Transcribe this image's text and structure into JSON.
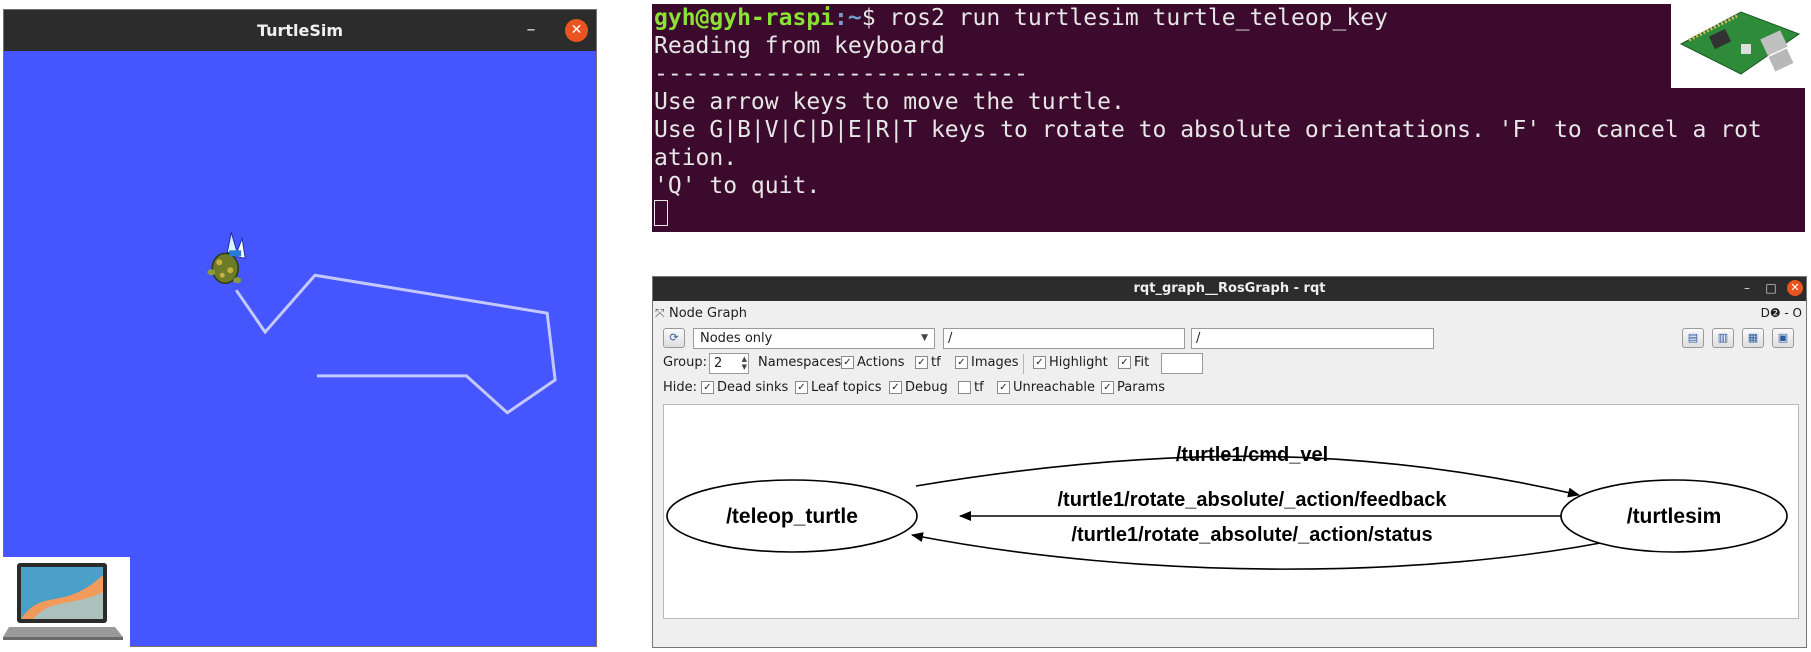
{
  "turtlesim": {
    "title": "TurtleSim",
    "minimize_glyph": "–",
    "close_glyph": "✕",
    "colors": {
      "background": "#4556fe",
      "titlebar": "#2c2c2c",
      "close": "#e95420",
      "path": "#c3c8ff"
    }
  },
  "terminal": {
    "prompt_user": "gyh@gyh-raspi",
    "prompt_path": ":~",
    "prompt_symbol": "$ ",
    "command": "ros2 run turtlesim turtle_teleop_key",
    "lines": [
      "Reading from keyboard",
      "---------------------------",
      "Use arrow keys to move the turtle.",
      "Use G|B|V|C|D|E|R|T keys to rotate to absolute orientations. 'F' to cancel a rot",
      "ation.",
      "'Q' to quit."
    ],
    "colors": {
      "background": "#3c0a2d",
      "user": "#8ae234",
      "path": "#729fcf"
    }
  },
  "rqt": {
    "title": "rqt_graph__RosGraph - rqt",
    "window_buttons": {
      "minimize": "–",
      "maximize": "□",
      "close": "✕"
    },
    "plugin_title": "Node Graph",
    "plugin_controls": "D❷ - O",
    "toolbar": {
      "refresh_icon": "⟳",
      "mode_value": "Nodes only",
      "filter_1": "/",
      "filter_2": "/",
      "group_label": "Group:",
      "group_value": "2",
      "options": [
        {
          "label": "Namespaces",
          "checked": true
        },
        {
          "label": "Actions",
          "checked": true
        },
        {
          "label": "tf",
          "checked": true
        },
        {
          "label": "Images",
          "checked": true
        },
        {
          "label": "Highlight",
          "checked": true
        },
        {
          "label": "Fit",
          "checked": true
        }
      ],
      "hide_label": "Hide:",
      "hide_options": [
        {
          "label": "Dead sinks",
          "checked": true
        },
        {
          "label": "Leaf topics",
          "checked": true
        },
        {
          "label": "Debug",
          "checked": true
        },
        {
          "label": "tf",
          "checked": false
        },
        {
          "label": "Unreachable",
          "checked": true
        },
        {
          "label": "Params",
          "checked": true
        }
      ],
      "right_icons": [
        "save-dot-icon",
        "load-icon",
        "save-svg-icon",
        "screenshot-icon"
      ]
    },
    "graph": {
      "nodes": [
        {
          "name": "/teleop_turtle"
        },
        {
          "name": "/turtlesim"
        }
      ],
      "edges": [
        {
          "label": "/turtle1/cmd_vel",
          "from": "/teleop_turtle",
          "to": "/turtlesim"
        },
        {
          "label": "/turtle1/rotate_absolute/_action/feedback",
          "from": "/turtlesim",
          "to": "/teleop_turtle"
        },
        {
          "label": "/turtle1/rotate_absolute/_action/status",
          "from": "/turtlesim",
          "to": "/teleop_turtle"
        }
      ]
    }
  }
}
